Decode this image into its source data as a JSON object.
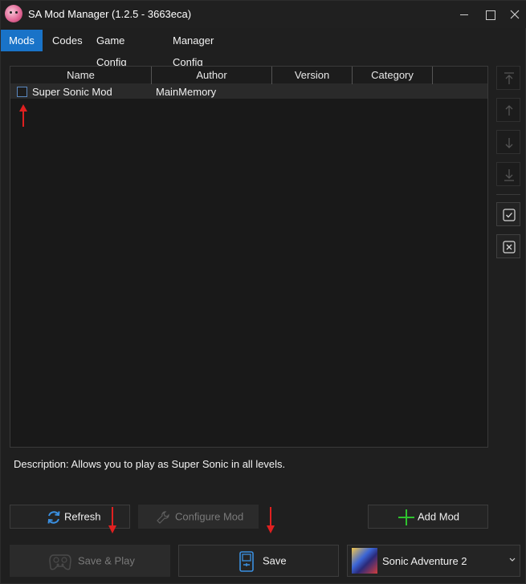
{
  "window": {
    "title": "SA Mod Manager (1.2.5 - 3663eca)"
  },
  "tabs": [
    {
      "label": "Mods",
      "active": true
    },
    {
      "label": "Codes",
      "active": false
    },
    {
      "label": "Game Config",
      "active": false
    },
    {
      "label": "Manager Config",
      "active": false
    }
  ],
  "mod_list": {
    "columns": [
      "Name",
      "Author",
      "Version",
      "Category"
    ],
    "rows": [
      {
        "checked": false,
        "name": "Super Sonic Mod",
        "author": "MainMemory",
        "version": "",
        "category": ""
      }
    ]
  },
  "side_buttons": [
    {
      "icon": "move-to-top-icon",
      "enabled": false
    },
    {
      "icon": "move-up-icon",
      "enabled": false
    },
    {
      "icon": "move-down-icon",
      "enabled": false
    },
    {
      "icon": "move-to-bottom-icon",
      "enabled": false
    },
    {
      "icon": "check-all-icon",
      "enabled": true
    },
    {
      "icon": "uncheck-all-icon",
      "enabled": true
    }
  ],
  "description": "Description: Allows you to play as Super Sonic in all levels.",
  "buttons": {
    "refresh": "Refresh",
    "configure_mod": "Configure Mod",
    "add_mod": "Add Mod",
    "save_play": "Save & Play",
    "save": "Save"
  },
  "game_selector": {
    "selected": "Sonic Adventure 2"
  },
  "colors": {
    "accent": "#1973c8",
    "annotation": "#e02020",
    "add_icon": "#2ec32e",
    "refresh_icon": "#3a8fe0",
    "save_icon": "#3a8fe0"
  }
}
